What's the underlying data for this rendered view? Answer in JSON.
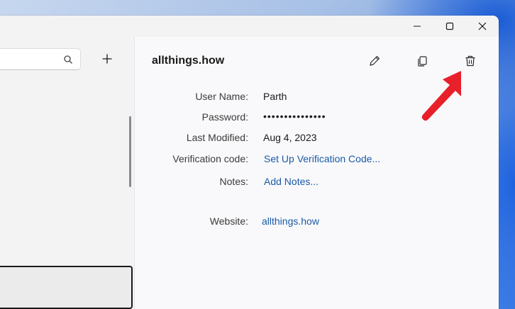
{
  "search": {
    "placeholder": ""
  },
  "entry": {
    "title": "allthings.how",
    "fields": {
      "user_name": {
        "label": "User Name:",
        "value": "Parth"
      },
      "password": {
        "label": "Password:",
        "value": "•••••••••••••••"
      },
      "last_modified": {
        "label": "Last Modified:",
        "value": "Aug 4, 2023"
      },
      "verification": {
        "label": "Verification code:",
        "value": "Set Up Verification Code..."
      },
      "notes": {
        "label": "Notes:",
        "value": "Add Notes..."
      },
      "website": {
        "label": "Website:",
        "value": "allthings.how"
      }
    }
  },
  "icons": {
    "search": "search-icon",
    "add": "plus-icon",
    "edit": "pencil-icon",
    "copy": "copy-icon",
    "delete": "trash-icon",
    "minimize": "minimize-icon",
    "maximize": "maximize-icon",
    "close": "close-icon"
  },
  "colors": {
    "link": "#1a5aa6",
    "annotation_arrow": "#e8202a"
  }
}
